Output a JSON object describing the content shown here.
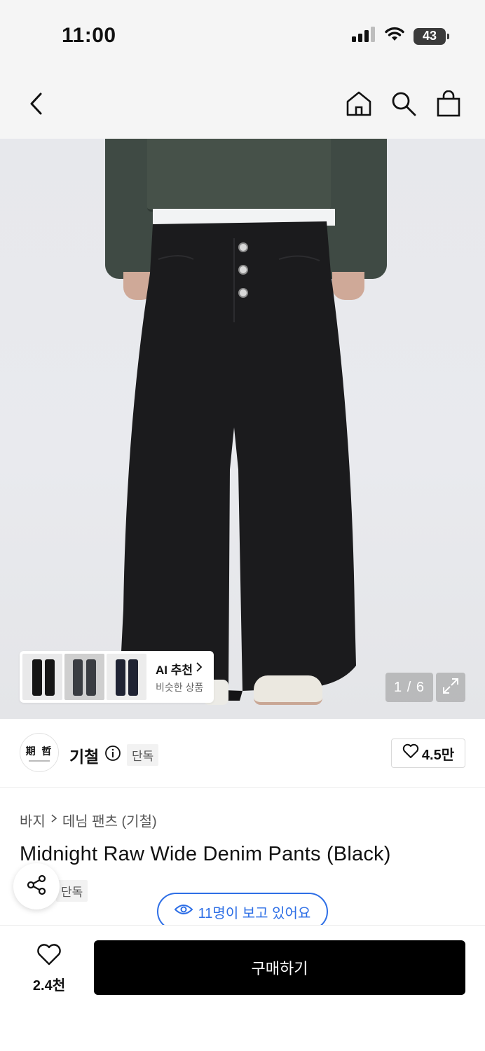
{
  "status": {
    "time": "11:00",
    "battery": "43",
    "icons": [
      "signal-icon",
      "wifi-icon",
      "battery-icon"
    ]
  },
  "nav": {
    "icons": [
      "back-icon",
      "home-icon",
      "search-icon",
      "shopping-bag-icon"
    ]
  },
  "gallery": {
    "counter": "1 / 6",
    "ai_recommend": {
      "title": "AI 추천",
      "subtitle": "비슷한 상품"
    }
  },
  "brand": {
    "logo_text": "期 哲",
    "name": "기철",
    "badge": "단독",
    "likes": "4.5만"
  },
  "breadcrumb": {
    "category": "바지",
    "subcategory": "데님 팬츠 (기철)"
  },
  "product": {
    "title": "Midnight Raw Wide Denim Pants (Black)",
    "badge": "단독"
  },
  "viewers": {
    "text": "11명이 보고 있어요"
  },
  "bottom": {
    "wish_count": "2.4천",
    "buy_label": "구매하기"
  },
  "colors": {
    "accent_blue": "#2e6fe6",
    "buy_button": "#000000"
  }
}
